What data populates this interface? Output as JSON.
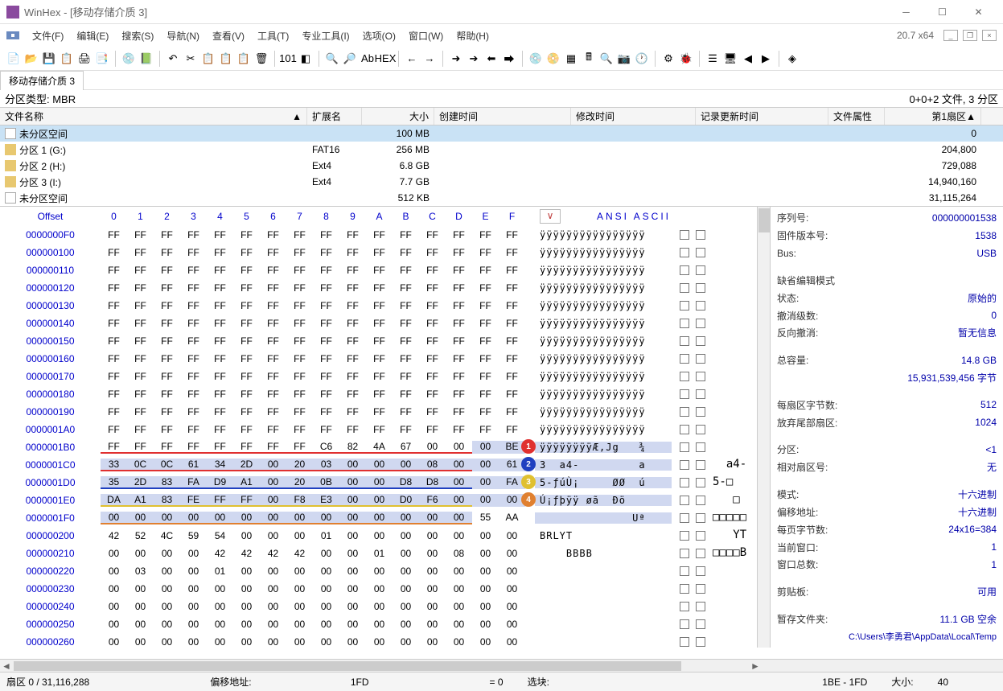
{
  "title": "WinHex - [移动存储介质 3]",
  "version": "20.7 x64",
  "menu": {
    "file": "文件(F)",
    "edit": "编辑(E)",
    "search": "搜索(S)",
    "nav": "导航(N)",
    "view": "查看(V)",
    "tools": "工具(T)",
    "pro_tools": "专业工具(I)",
    "options": "选项(O)",
    "window": "窗口(W)",
    "help": "帮助(H)"
  },
  "tab": "移动存储介质 3",
  "partition_bar": {
    "left": "分区类型: MBR",
    "right": "0+0+2 文件, 3 分区"
  },
  "file_table": {
    "headers": {
      "name": "文件名称",
      "ext": "扩展名",
      "size": "大小",
      "ctime": "创建时间",
      "mtime": "修改时间",
      "atime": "记录更新时间",
      "attr": "文件属性",
      "sector": "第1扇区"
    },
    "rows": [
      {
        "icon": "doc",
        "name": "未分区空间",
        "ext": "",
        "size": "100 MB",
        "sector": "0",
        "sel": true
      },
      {
        "icon": "part",
        "name": "分区 1 (G:)",
        "ext": "FAT16",
        "size": "256 MB",
        "sector": "204,800"
      },
      {
        "icon": "part",
        "name": "分区 2 (H:)",
        "ext": "Ext4",
        "size": "6.8 GB",
        "sector": "729,088"
      },
      {
        "icon": "part",
        "name": "分区 3 (I:)",
        "ext": "Ext4",
        "size": "7.7 GB",
        "sector": "14,940,160"
      },
      {
        "icon": "doc",
        "name": "未分区空间",
        "ext": "",
        "size": "512 KB",
        "sector": "31,115,264"
      }
    ]
  },
  "hex_header": {
    "offset": "Offset",
    "cols": [
      "0",
      "1",
      "2",
      "3",
      "4",
      "5",
      "6",
      "7",
      "8",
      "9",
      "A",
      "B",
      "C",
      "D",
      "E",
      "F"
    ],
    "v": "∨",
    "ascii": "ANSI ASCII"
  },
  "hex_rows": [
    {
      "off": "0000000F0",
      "b": [
        "FF",
        "FF",
        "FF",
        "FF",
        "FF",
        "FF",
        "FF",
        "FF",
        "FF",
        "FF",
        "FF",
        "FF",
        "FF",
        "FF",
        "FF",
        "FF"
      ],
      "a": "ÿÿÿÿÿÿÿÿÿÿÿÿÿÿÿÿ"
    },
    {
      "off": "000000100",
      "b": [
        "FF",
        "FF",
        "FF",
        "FF",
        "FF",
        "FF",
        "FF",
        "FF",
        "FF",
        "FF",
        "FF",
        "FF",
        "FF",
        "FF",
        "FF",
        "FF"
      ],
      "a": "ÿÿÿÿÿÿÿÿÿÿÿÿÿÿÿÿ"
    },
    {
      "off": "000000110",
      "b": [
        "FF",
        "FF",
        "FF",
        "FF",
        "FF",
        "FF",
        "FF",
        "FF",
        "FF",
        "FF",
        "FF",
        "FF",
        "FF",
        "FF",
        "FF",
        "FF"
      ],
      "a": "ÿÿÿÿÿÿÿÿÿÿÿÿÿÿÿÿ"
    },
    {
      "off": "000000120",
      "b": [
        "FF",
        "FF",
        "FF",
        "FF",
        "FF",
        "FF",
        "FF",
        "FF",
        "FF",
        "FF",
        "FF",
        "FF",
        "FF",
        "FF",
        "FF",
        "FF"
      ],
      "a": "ÿÿÿÿÿÿÿÿÿÿÿÿÿÿÿÿ"
    },
    {
      "off": "000000130",
      "b": [
        "FF",
        "FF",
        "FF",
        "FF",
        "FF",
        "FF",
        "FF",
        "FF",
        "FF",
        "FF",
        "FF",
        "FF",
        "FF",
        "FF",
        "FF",
        "FF"
      ],
      "a": "ÿÿÿÿÿÿÿÿÿÿÿÿÿÿÿÿ"
    },
    {
      "off": "000000140",
      "b": [
        "FF",
        "FF",
        "FF",
        "FF",
        "FF",
        "FF",
        "FF",
        "FF",
        "FF",
        "FF",
        "FF",
        "FF",
        "FF",
        "FF",
        "FF",
        "FF"
      ],
      "a": "ÿÿÿÿÿÿÿÿÿÿÿÿÿÿÿÿ"
    },
    {
      "off": "000000150",
      "b": [
        "FF",
        "FF",
        "FF",
        "FF",
        "FF",
        "FF",
        "FF",
        "FF",
        "FF",
        "FF",
        "FF",
        "FF",
        "FF",
        "FF",
        "FF",
        "FF"
      ],
      "a": "ÿÿÿÿÿÿÿÿÿÿÿÿÿÿÿÿ"
    },
    {
      "off": "000000160",
      "b": [
        "FF",
        "FF",
        "FF",
        "FF",
        "FF",
        "FF",
        "FF",
        "FF",
        "FF",
        "FF",
        "FF",
        "FF",
        "FF",
        "FF",
        "FF",
        "FF"
      ],
      "a": "ÿÿÿÿÿÿÿÿÿÿÿÿÿÿÿÿ"
    },
    {
      "off": "000000170",
      "b": [
        "FF",
        "FF",
        "FF",
        "FF",
        "FF",
        "FF",
        "FF",
        "FF",
        "FF",
        "FF",
        "FF",
        "FF",
        "FF",
        "FF",
        "FF",
        "FF"
      ],
      "a": "ÿÿÿÿÿÿÿÿÿÿÿÿÿÿÿÿ"
    },
    {
      "off": "000000180",
      "b": [
        "FF",
        "FF",
        "FF",
        "FF",
        "FF",
        "FF",
        "FF",
        "FF",
        "FF",
        "FF",
        "FF",
        "FF",
        "FF",
        "FF",
        "FF",
        "FF"
      ],
      "a": "ÿÿÿÿÿÿÿÿÿÿÿÿÿÿÿÿ"
    },
    {
      "off": "000000190",
      "b": [
        "FF",
        "FF",
        "FF",
        "FF",
        "FF",
        "FF",
        "FF",
        "FF",
        "FF",
        "FF",
        "FF",
        "FF",
        "FF",
        "FF",
        "FF",
        "FF"
      ],
      "a": "ÿÿÿÿÿÿÿÿÿÿÿÿÿÿÿÿ"
    },
    {
      "off": "0000001A0",
      "b": [
        "FF",
        "FF",
        "FF",
        "FF",
        "FF",
        "FF",
        "FF",
        "FF",
        "FF",
        "FF",
        "FF",
        "FF",
        "FF",
        "FF",
        "FF",
        "FF"
      ],
      "a": "ÿÿÿÿÿÿÿÿÿÿÿÿÿÿÿÿ"
    },
    {
      "off": "0000001B0",
      "b": [
        "FF",
        "FF",
        "FF",
        "FF",
        "FF",
        "FF",
        "FF",
        "FF",
        "C6",
        "82",
        "4A",
        "67",
        "00",
        "00",
        "00",
        "BE"
      ],
      "a": "ÿÿÿÿÿÿÿÿÆ‚Jg   ¾",
      "hl": [
        14,
        15
      ],
      "ul": "red",
      "marker": {
        "n": "1",
        "c": "#e03030"
      }
    },
    {
      "off": "0000001C0",
      "b": [
        "33",
        "0C",
        "0C",
        "61",
        "34",
        "2D",
        "00",
        "20",
        "03",
        "00",
        "00",
        "00",
        "08",
        "00",
        "00",
        "61"
      ],
      "a": "3  a4-         a",
      "hl": [
        0,
        15
      ],
      "ul": "red",
      "marker": {
        "n": "2",
        "c": "#2040c0"
      },
      "ext": "  a4-"
    },
    {
      "off": "0000001D0",
      "b": [
        "35",
        "2D",
        "83",
        "FA",
        "D9",
        "A1",
        "00",
        "20",
        "0B",
        "00",
        "00",
        "D8",
        "D8",
        "00",
        "00",
        "FA"
      ],
      "a": "5-ƒúÙ¡     ØØ  ú",
      "hl": [
        0,
        15
      ],
      "ul": "blue",
      "marker": {
        "n": "3",
        "c": "#e0c030"
      },
      "ext": "5-□"
    },
    {
      "off": "0000001E0",
      "b": [
        "DA",
        "A1",
        "83",
        "FE",
        "FF",
        "FF",
        "00",
        "F8",
        "E3",
        "00",
        "00",
        "D0",
        "F6",
        "00",
        "00",
        "00"
      ],
      "a": "Ú¡ƒþÿÿ øã  Ðö   ",
      "hl": [
        0,
        15
      ],
      "ul": "yellow",
      "marker": {
        "n": "4",
        "c": "#e08030"
      },
      "ext": "   □"
    },
    {
      "off": "0000001F0",
      "b": [
        "00",
        "00",
        "00",
        "00",
        "00",
        "00",
        "00",
        "00",
        "00",
        "00",
        "00",
        "00",
        "00",
        "00",
        "55",
        "AA"
      ],
      "a": "              Uª",
      "hl": [
        0,
        13
      ],
      "ul": "orange",
      "ext": "□□□□□"
    },
    {
      "off": "000000200",
      "b": [
        "42",
        "52",
        "4C",
        "59",
        "54",
        "00",
        "00",
        "00",
        "01",
        "00",
        "00",
        "00",
        "00",
        "00",
        "00",
        "00"
      ],
      "a": "BRLYT           ",
      "ext": "   YT"
    },
    {
      "off": "000000210",
      "b": [
        "00",
        "00",
        "00",
        "00",
        "42",
        "42",
        "42",
        "42",
        "00",
        "00",
        "01",
        "00",
        "00",
        "08",
        "00",
        "00"
      ],
      "a": "    BBBB        ",
      "ext": "□□□□B"
    },
    {
      "off": "000000220",
      "b": [
        "00",
        "03",
        "00",
        "00",
        "01",
        "00",
        "00",
        "00",
        "00",
        "00",
        "00",
        "00",
        "00",
        "00",
        "00",
        "00"
      ],
      "a": "                "
    },
    {
      "off": "000000230",
      "b": [
        "00",
        "00",
        "00",
        "00",
        "00",
        "00",
        "00",
        "00",
        "00",
        "00",
        "00",
        "00",
        "00",
        "00",
        "00",
        "00"
      ],
      "a": "                "
    },
    {
      "off": "000000240",
      "b": [
        "00",
        "00",
        "00",
        "00",
        "00",
        "00",
        "00",
        "00",
        "00",
        "00",
        "00",
        "00",
        "00",
        "00",
        "00",
        "00"
      ],
      "a": "                "
    },
    {
      "off": "000000250",
      "b": [
        "00",
        "00",
        "00",
        "00",
        "00",
        "00",
        "00",
        "00",
        "00",
        "00",
        "00",
        "00",
        "00",
        "00",
        "00",
        "00"
      ],
      "a": "                "
    },
    {
      "off": "000000260",
      "b": [
        "00",
        "00",
        "00",
        "00",
        "00",
        "00",
        "00",
        "00",
        "00",
        "00",
        "00",
        "00",
        "00",
        "00",
        "00",
        "00"
      ],
      "a": "                "
    }
  ],
  "info": [
    {
      "lbl": "序列号:",
      "val": "000000001538"
    },
    {
      "lbl": "固件版本号:",
      "val": "1538"
    },
    {
      "lbl": "Bus:",
      "val": "USB"
    },
    {
      "sep": true
    },
    {
      "lbl": "缺省编辑模式",
      "val": ""
    },
    {
      "lbl": "状态:",
      "val": "原始的"
    },
    {
      "lbl": "撤消级数:",
      "val": "0"
    },
    {
      "lbl": "反向撤消:",
      "val": "暂无信息"
    },
    {
      "sep": true
    },
    {
      "lbl": "总容量:",
      "val": "14.8 GB"
    },
    {
      "lbl": "",
      "val": "15,931,539,456 字节"
    },
    {
      "sep": true
    },
    {
      "lbl": "每扇区字节数:",
      "val": "512"
    },
    {
      "lbl": "放弃尾部扇区:",
      "val": "1024"
    },
    {
      "sep": true
    },
    {
      "lbl": "分区:",
      "val": "<1"
    },
    {
      "lbl": "相对扇区号:",
      "val": "无"
    },
    {
      "sep": true
    },
    {
      "lbl": "模式:",
      "val": "十六进制"
    },
    {
      "lbl": "偏移地址:",
      "val": "十六进制"
    },
    {
      "lbl": "每页字节数:",
      "val": "24x16=384"
    },
    {
      "lbl": "当前窗口:",
      "val": "1"
    },
    {
      "lbl": "窗口总数:",
      "val": "1"
    },
    {
      "sep": true
    },
    {
      "lbl": "剪贴板:",
      "val": "可用"
    },
    {
      "sep": true
    },
    {
      "lbl": "暂存文件夹:",
      "val": "11.1 GB 空余"
    },
    {
      "lbl": "",
      "val": "C:\\Users\\李勇君\\AppData\\Local\\Temp",
      "path": true
    }
  ],
  "status": {
    "sector": "扇区 0 / 31,116,288",
    "offset_lbl": "偏移地址:",
    "offset_val": "1FD",
    "eq": "= 0",
    "sel_lbl": "选块:",
    "sel_val": "1BE - 1FD",
    "size_lbl": "大小:",
    "size_val": "40"
  }
}
